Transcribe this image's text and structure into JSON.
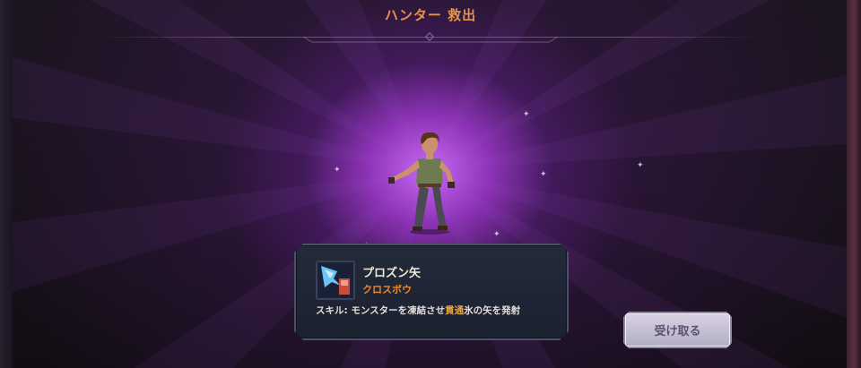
{
  "header": {
    "title": "ハンター 救出"
  },
  "hero": {
    "icon": "hunter-character"
  },
  "skill_card": {
    "icon": "frozen-arrow-icon",
    "name": "プロズン矢",
    "weapon_type": "クロスボウ",
    "description_prefix": "スキル: モンスターを凍結させ",
    "description_highlight": "貫通",
    "description_suffix": "氷の矢を発射"
  },
  "actions": {
    "receive_label": "受け取る"
  },
  "colors": {
    "title": "#e6934a",
    "weapon_type": "#e8882e",
    "highlight": "#e8a33a",
    "glow": "#c46cf0"
  }
}
